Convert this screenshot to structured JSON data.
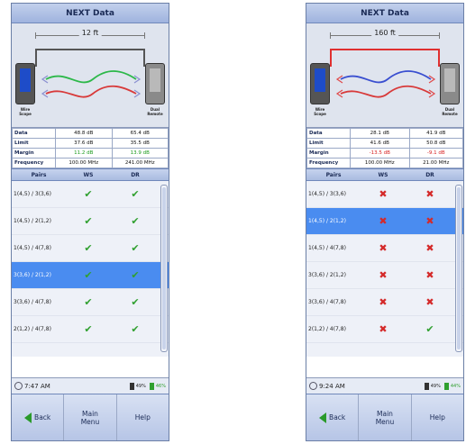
{
  "screens": [
    {
      "id": "left",
      "title": "NEXT Data",
      "length": "12 ft",
      "fail_cable": false,
      "unit_labels": {
        "left": "Wire Scope",
        "right": "Dual Remote"
      },
      "rows": [
        {
          "label": "Data",
          "ws": "48.8 dB",
          "dr": "65.4 dB",
          "ws_status": "",
          "dr_status": ""
        },
        {
          "label": "Limit",
          "ws": "37.6 dB",
          "dr": "35.5 dB",
          "ws_status": "",
          "dr_status": ""
        },
        {
          "label": "Margin",
          "ws": "11.2 dB",
          "dr": "13.9 dB",
          "ws_status": "pass",
          "dr_status": "pass"
        },
        {
          "label": "Frequency",
          "ws": "100.00 MHz",
          "dr": "241.00 MHz",
          "ws_status": "",
          "dr_status": ""
        }
      ],
      "columns": [
        "Pairs",
        "WS",
        "DR"
      ],
      "pairs": [
        {
          "name": "1(4,5) / 3(3,6)",
          "ws": "pass",
          "dr": "pass",
          "selected": false
        },
        {
          "name": "1(4,5) / 2(1,2)",
          "ws": "pass",
          "dr": "pass",
          "selected": false
        },
        {
          "name": "1(4,5) / 4(7,8)",
          "ws": "pass",
          "dr": "pass",
          "selected": false
        },
        {
          "name": "3(3,6) / 2(1,2)",
          "ws": "pass",
          "dr": "pass",
          "selected": true
        },
        {
          "name": "3(3,6) / 4(7,8)",
          "ws": "pass",
          "dr": "pass",
          "selected": false
        },
        {
          "name": "2(1,2) / 4(7,8)",
          "ws": "pass",
          "dr": "pass",
          "selected": false
        }
      ],
      "time": "7:47 AM",
      "battery_ws": "49%",
      "battery_dr": "46%",
      "buttons": {
        "back": "Back",
        "main_menu": "Main Menu",
        "help": "Help"
      }
    },
    {
      "id": "right",
      "title": "NEXT Data",
      "length": "160 ft",
      "fail_cable": true,
      "unit_labels": {
        "left": "Wire Scope",
        "right": "Dual Remote"
      },
      "rows": [
        {
          "label": "Data",
          "ws": "28.1 dB",
          "dr": "41.9 dB",
          "ws_status": "",
          "dr_status": ""
        },
        {
          "label": "Limit",
          "ws": "41.6 dB",
          "dr": "50.8 dB",
          "ws_status": "",
          "dr_status": ""
        },
        {
          "label": "Margin",
          "ws": "-13.5 dB",
          "dr": "-9.1 dB",
          "ws_status": "fail",
          "dr_status": "fail"
        },
        {
          "label": "Frequency",
          "ws": "100.00 MHz",
          "dr": "21.00 MHz",
          "ws_status": "",
          "dr_status": ""
        }
      ],
      "columns": [
        "Pairs",
        "WS",
        "DR"
      ],
      "pairs": [
        {
          "name": "1(4,5) / 3(3,6)",
          "ws": "fail",
          "dr": "fail",
          "selected": false
        },
        {
          "name": "1(4,5) / 2(1,2)",
          "ws": "fail",
          "dr": "fail",
          "selected": true
        },
        {
          "name": "1(4,5) / 4(7,8)",
          "ws": "fail",
          "dr": "fail",
          "selected": false
        },
        {
          "name": "3(3,6) / 2(1,2)",
          "ws": "fail",
          "dr": "fail",
          "selected": false
        },
        {
          "name": "3(3,6) / 4(7,8)",
          "ws": "fail",
          "dr": "fail",
          "selected": false
        },
        {
          "name": "2(1,2) / 4(7,8)",
          "ws": "fail",
          "dr": "pass",
          "selected": false
        }
      ],
      "time": "9:24 AM",
      "battery_ws": "49%",
      "battery_dr": "44%",
      "buttons": {
        "back": "Back",
        "main_menu": "Main Menu",
        "help": "Help"
      }
    }
  ],
  "icons": {
    "pass": "check-icon",
    "fail": "cross-icon"
  },
  "colors": {
    "pass": "#30a030",
    "fail": "#d42a2a",
    "selected": "#4a8cf0",
    "title_bar": "#9fb3de"
  }
}
